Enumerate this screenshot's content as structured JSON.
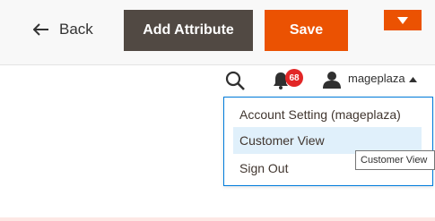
{
  "toolbar": {
    "back_label": "Back",
    "add_attribute_label": "Add Attribute",
    "save_label": "Save"
  },
  "header": {
    "notification_count": "68",
    "username": "mageplaza"
  },
  "user_menu": {
    "items": [
      {
        "label": "Account Setting (mageplaza)"
      },
      {
        "label": "Customer View"
      },
      {
        "label": "Sign Out"
      }
    ],
    "hovered_index": 1,
    "tooltip": "Customer View"
  },
  "colors": {
    "primary_orange": "#eb5202",
    "dark_button": "#514943",
    "menu_hover": "#e0f0fb",
    "badge_red": "#e22626"
  },
  "icons": [
    "arrow-left-icon",
    "chevron-down-icon",
    "search-icon",
    "bell-icon",
    "user-icon",
    "caret-up-icon"
  ]
}
